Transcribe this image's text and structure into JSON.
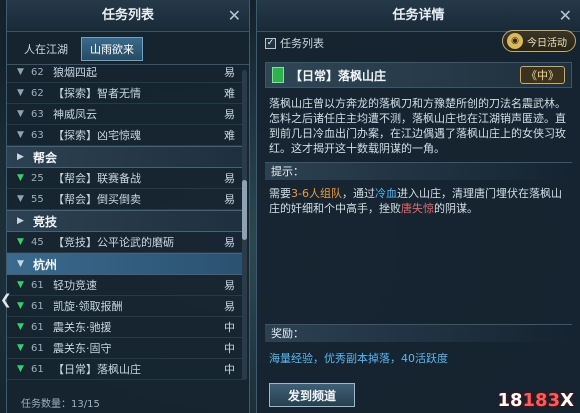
{
  "left_panel": {
    "title": "任务列表",
    "close_icon": "✕",
    "tabs": [
      {
        "label": "人在江湖",
        "active": false
      },
      {
        "label": "山雨欲来",
        "active": true
      }
    ],
    "rows": [
      {
        "kind": "item",
        "chev": "▼",
        "chev_color": "blue",
        "level": "62",
        "name": "狼烟四起",
        "diff": "易"
      },
      {
        "kind": "item",
        "chev": "▼",
        "chev_color": "blue",
        "level": "62",
        "name": "【探索】智者无情",
        "diff": "难"
      },
      {
        "kind": "item",
        "chev": "▼",
        "chev_color": "blue",
        "level": "63",
        "name": "神威凤云",
        "diff": "易"
      },
      {
        "kind": "item",
        "chev": "▼",
        "chev_color": "blue",
        "level": "63",
        "name": "【探索】凶宅惊魂",
        "diff": "难"
      },
      {
        "kind": "group",
        "chev": "▶",
        "name": "帮会",
        "selected": false
      },
      {
        "kind": "item",
        "chev": "▼",
        "chev_color": "green",
        "level": "25",
        "name": "【帮会】联赛备战",
        "diff": "易"
      },
      {
        "kind": "item",
        "chev": "▼",
        "chev_color": "blue",
        "level": "55",
        "name": "【帮会】倒买倒卖",
        "diff": "易"
      },
      {
        "kind": "group",
        "chev": "▶",
        "name": "竞技",
        "selected": false
      },
      {
        "kind": "item",
        "chev": "▼",
        "chev_color": "green",
        "level": "45",
        "name": "【竞技】公平论武的磨砺",
        "diff": "易"
      },
      {
        "kind": "group",
        "chev": "▼",
        "name": "杭州",
        "selected": true
      },
      {
        "kind": "item",
        "chev": "▼",
        "chev_color": "green",
        "level": "61",
        "name": "轻功竞速",
        "diff": "易"
      },
      {
        "kind": "item",
        "chev": "▼",
        "chev_color": "green",
        "level": "61",
        "name": "凯旋·领取报酬",
        "diff": "易"
      },
      {
        "kind": "item",
        "chev": "▼",
        "chev_color": "green",
        "level": "61",
        "name": "震关东·驰援",
        "diff": "中"
      },
      {
        "kind": "item",
        "chev": "▼",
        "chev_color": "green",
        "level": "61",
        "name": "震关东·固守",
        "diff": "中"
      },
      {
        "kind": "item",
        "chev": "▼",
        "chev_color": "green",
        "level": "61",
        "name": "【日常】落枫山庄",
        "diff": "中"
      }
    ],
    "task_count_label": "任务数量：13/15",
    "side_arrow": "❮"
  },
  "right_panel": {
    "title": "任务详情",
    "close_icon": "✕",
    "checkbox_label": "任务列表",
    "checkbox_checked": true,
    "today_button": "今日活动",
    "quest_title": "【日常】落枫山庄",
    "quest_difficulty": "中",
    "description": "落枫山庄曾以方奔龙的落枫刀和方豫楚所创的刀法名震武林。怎料之后诸任庄主均遭不测，落枫山庄也在江湖销声匿迹。直到前几日冷血出门办案，在江边偶遇了落枫山庄上的女侠习玫红。这才揭开这十数载阴谋的一角。",
    "hint_label": "提示：",
    "hint": {
      "p1": "需要",
      "p2": "3-6人组队",
      "p3": "，通过",
      "p4": "冷血",
      "p5": "进入山庄，清理唐门埋伏在落枫山庄的奸细和个中高手，挫败",
      "p6": "唐失惊",
      "p7": "的阴谋。"
    },
    "reward_label": "奖励：",
    "reward_text": "海量经验，优秀副本掉落，40活跃度",
    "send_button": "发到频道"
  },
  "watermark": {
    "part1": "18",
    "part2": "183",
    "part3": "X"
  },
  "colors": {
    "accent_green": "#35d06b",
    "highlight_orange": "#f29b3b",
    "highlight_blue": "#55b6f0",
    "highlight_red": "#e56767",
    "gold": "#c7ab6a"
  }
}
